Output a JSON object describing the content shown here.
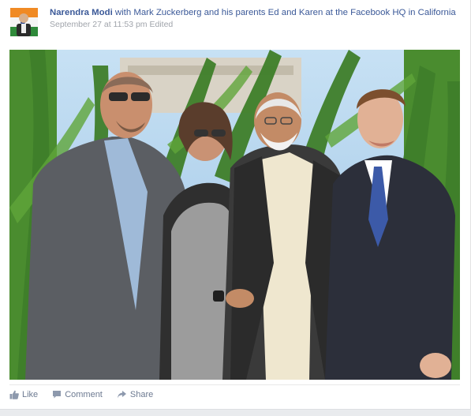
{
  "post": {
    "author": "Narendra Modi",
    "header_rest": "with Mark Zuckerberg and his parents Ed and Karen at the Facebook HQ in California",
    "timestamp": "September 27 at 11:53 pm",
    "edited": "Edited"
  },
  "actions": {
    "like": "Like",
    "comment": "Comment",
    "share": "Share"
  },
  "icons": {
    "like": "thumbs-up-icon",
    "comment": "speech-bubble-icon",
    "share": "share-arrow-icon"
  },
  "colors": {
    "link": "#3b5998",
    "meta": "#a0a4ab",
    "action_text": "#6d7a91",
    "photo_sky": "#b7d6ee",
    "corn_green": "#3f7f2a"
  }
}
